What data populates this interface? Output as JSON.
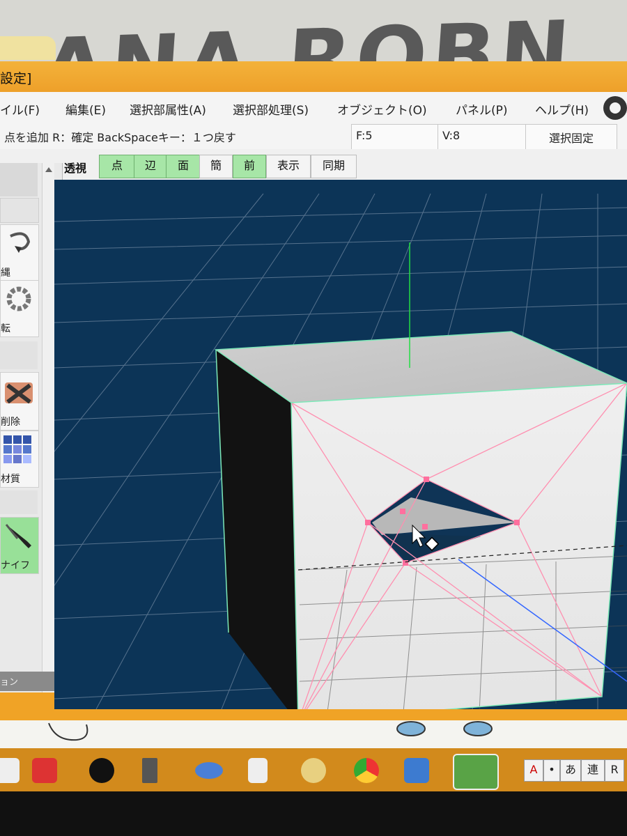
{
  "window": {
    "title": "設定]"
  },
  "menu": {
    "items": [
      "イル(F)",
      "編集(E)",
      "選択部属性(A)",
      "選択部処理(S)",
      "オブジェクト(O)",
      "パネル(P)",
      "ヘルプ(H)"
    ]
  },
  "status": {
    "hint": "点を追加  R：確定  BackSpaceキー：１つ戻す",
    "faces": "F:5",
    "vertices": "V:8",
    "fix_button": "選択固定"
  },
  "toolbar": {
    "view_label": "透視",
    "buttons": [
      "点",
      "辺",
      "面",
      "簡",
      "前",
      "表示",
      "同期"
    ]
  },
  "sidepanel": {
    "tools": [
      "縄",
      "転",
      "削除",
      "材質",
      "ナイフ"
    ],
    "footer": "ョン"
  },
  "tray": {
    "items": [
      "あ",
      "連",
      "R"
    ]
  },
  "colors": {
    "window_frame": "#f0a326",
    "viewport_bg": "#0c3457",
    "grid_line": "#6f87a0",
    "active_button": "#a7e6a7",
    "selection_edge": "#ff8fb0",
    "axis_green": "#22dd44",
    "axis_blue": "#3366ff"
  },
  "icons": {
    "app_logo": "hexagon-nut-icon",
    "cursor": "arrow-cursor-icon",
    "knife_cursor": "diamond-icon"
  }
}
